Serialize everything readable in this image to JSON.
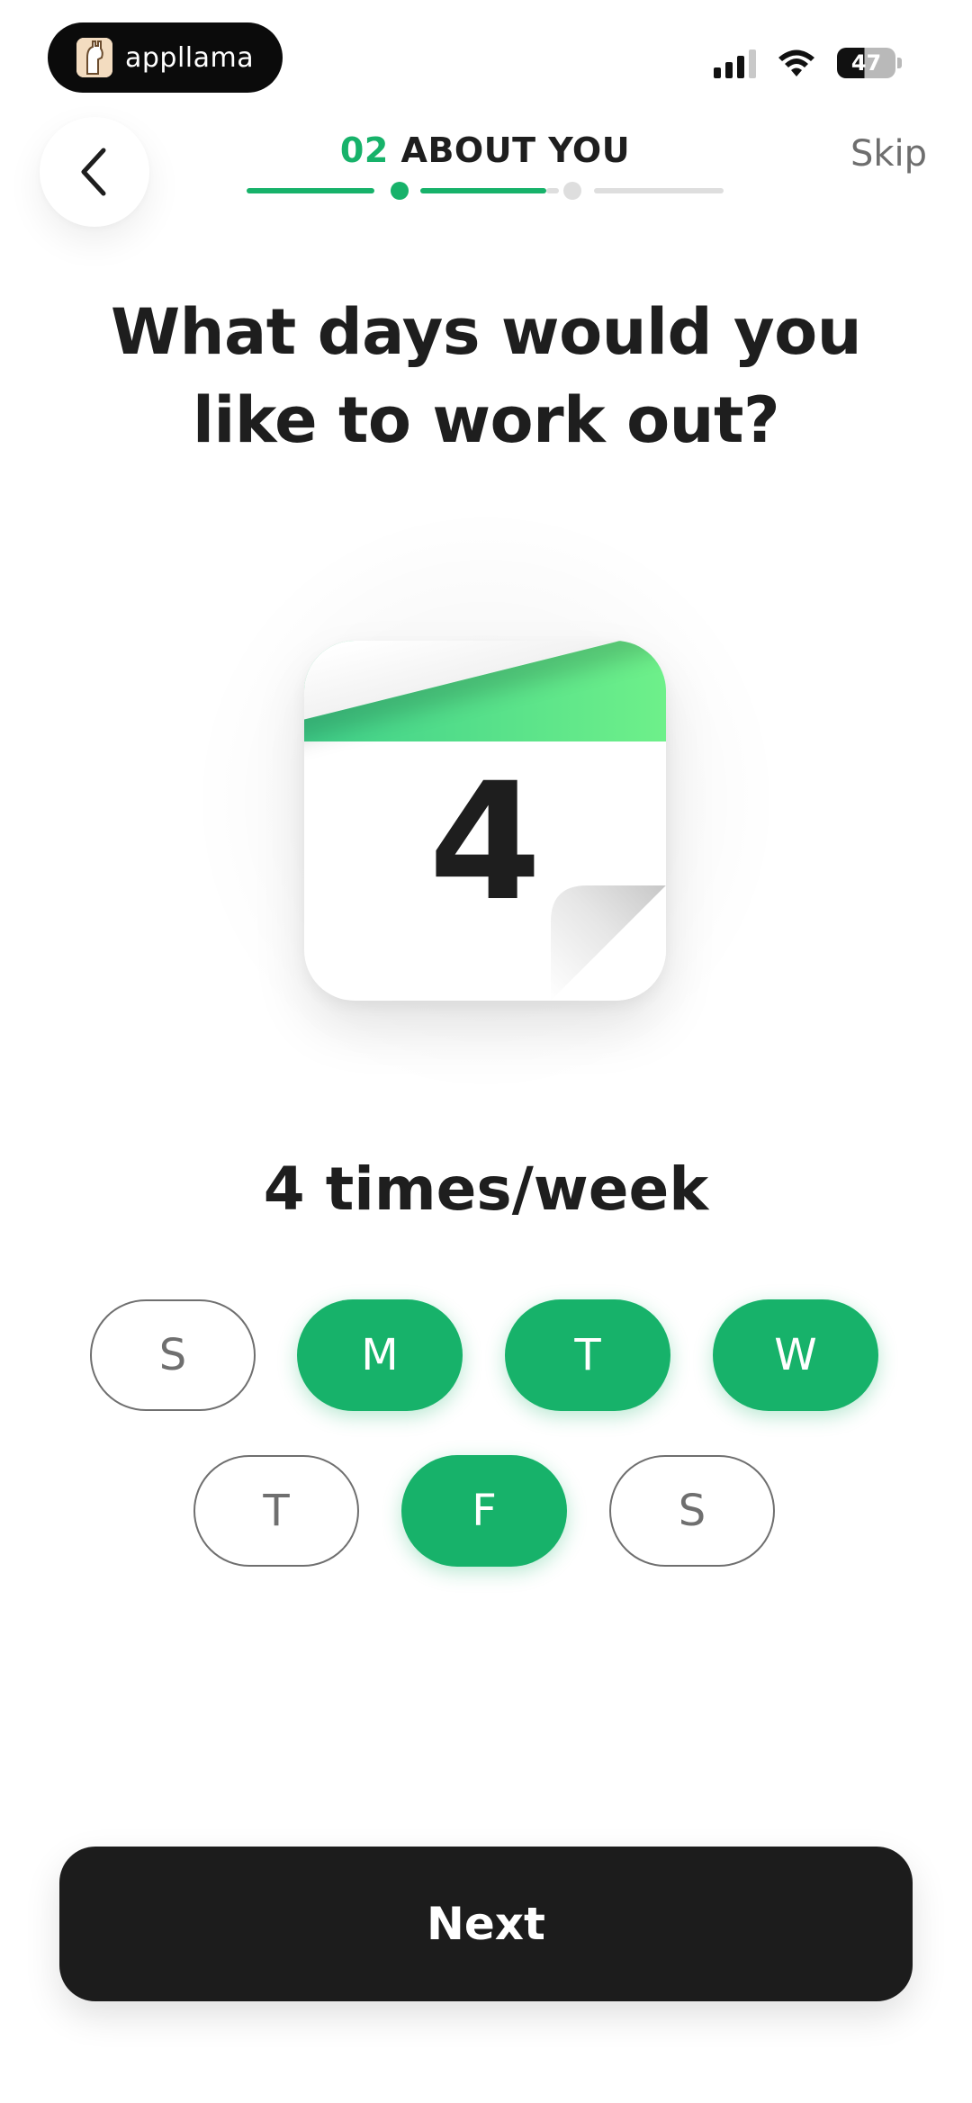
{
  "status_bar": {
    "app_name": "appllama",
    "battery": "47",
    "icons": [
      "app-logo-icon",
      "signal-icon",
      "wifi-icon",
      "battery-icon"
    ]
  },
  "header": {
    "back_icon": "chevron-left-icon",
    "step_number": "02",
    "step_label": "ABOUT YOU",
    "skip_label": "Skip"
  },
  "question": {
    "line1": "What days would you",
    "line2": "like to work out?"
  },
  "calendar": {
    "number": "4"
  },
  "frequency_text": "4 times/week",
  "days": [
    {
      "label": "S",
      "selected": false
    },
    {
      "label": "M",
      "selected": true
    },
    {
      "label": "T",
      "selected": true
    },
    {
      "label": "W",
      "selected": true
    },
    {
      "label": "T",
      "selected": false
    },
    {
      "label": "F",
      "selected": true
    },
    {
      "label": "S",
      "selected": false
    }
  ],
  "next_label": "Next",
  "colors": {
    "accent": "#17b26a",
    "text": "#1e1e1e",
    "button": "#1c1c1c",
    "muted": "#6f6f6f"
  }
}
